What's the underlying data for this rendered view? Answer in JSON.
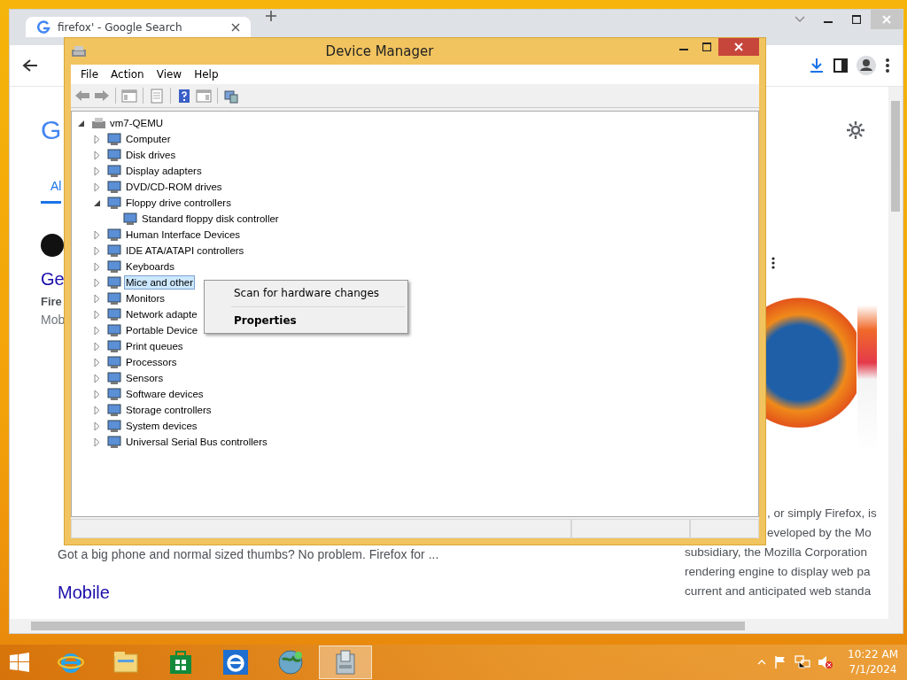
{
  "browser": {
    "tab": {
      "title": "firefox' - Google Search",
      "selected": true
    },
    "page_left": [
      {
        "kind": "logo",
        "text": "G"
      },
      {
        "kind": "tab",
        "text": "Al"
      },
      {
        "kind": "site-icon"
      },
      {
        "kind": "title",
        "text": "Ge"
      },
      {
        "kind": "bold",
        "text": "Fire"
      },
      {
        "kind": "plain",
        "text": "Mob"
      },
      {
        "kind": "desc",
        "text": "Got a big phone and normal sized thumbs? No problem. Firefox for ..."
      },
      {
        "kind": "link",
        "text": "Mobile"
      }
    ],
    "panel_lines": [
      {
        "text": ", or simply Firefox, is",
        "covered": true
      },
      {
        "text": "eveloped by the Mo",
        "covered": true
      },
      {
        "text": "subsidiary, the Mozilla Corporation",
        "covered": false
      },
      {
        "text": "rendering engine to display web pa",
        "covered": false
      },
      {
        "text": "current and anticipated web standa",
        "covered": false
      }
    ]
  },
  "device_manager": {
    "title": "Device Manager",
    "menu": [
      "File",
      "Action",
      "View",
      "Help"
    ],
    "tree": {
      "label": "vm7-QEMU",
      "expanded": true,
      "selected": false,
      "children": [
        {
          "label": "Computer",
          "expanded": false,
          "selected": false
        },
        {
          "label": "Disk drives",
          "expanded": false,
          "selected": false
        },
        {
          "label": "Display adapters",
          "expanded": false,
          "selected": false
        },
        {
          "label": "DVD/CD-ROM drives",
          "expanded": false,
          "selected": false
        },
        {
          "label": "Floppy drive controllers",
          "expanded": true,
          "selected": false,
          "children": [
            {
              "label": "Standard floppy disk controller",
              "selected": false
            }
          ]
        },
        {
          "label": "Human Interface Devices",
          "expanded": false,
          "selected": false
        },
        {
          "label": "IDE ATA/ATAPI controllers",
          "expanded": false,
          "selected": false
        },
        {
          "label": "Keyboards",
          "expanded": false,
          "selected": false
        },
        {
          "label": "Mice and other",
          "expanded": false,
          "selected": true
        },
        {
          "label": "Monitors",
          "expanded": false,
          "selected": false
        },
        {
          "label": "Network adapte",
          "expanded": false,
          "selected": false
        },
        {
          "label": "Portable Device",
          "expanded": false,
          "selected": false
        },
        {
          "label": "Print queues",
          "expanded": false,
          "selected": false
        },
        {
          "label": "Processors",
          "expanded": false,
          "selected": false
        },
        {
          "label": "Sensors",
          "expanded": false,
          "selected": false
        },
        {
          "label": "Software devices",
          "expanded": false,
          "selected": false
        },
        {
          "label": "Storage controllers",
          "expanded": false,
          "selected": false
        },
        {
          "label": "System devices",
          "expanded": false,
          "selected": false
        },
        {
          "label": "Universal Serial Bus controllers",
          "expanded": false,
          "selected": false
        }
      ]
    }
  },
  "context_menu": [
    {
      "label": "Scan for hardware changes",
      "default": false
    },
    {
      "label": "Properties",
      "default": true
    }
  ],
  "taskbar": {
    "apps": [
      {
        "kind": "ie",
        "selected": false
      },
      {
        "kind": "folder",
        "selected": false
      },
      {
        "kind": "store",
        "selected": false
      },
      {
        "kind": "ie-metro",
        "selected": false
      },
      {
        "kind": "globe",
        "selected": false
      },
      {
        "kind": "device",
        "selected": true
      }
    ],
    "time": "10:22 AM",
    "date": "7/1/2024"
  }
}
